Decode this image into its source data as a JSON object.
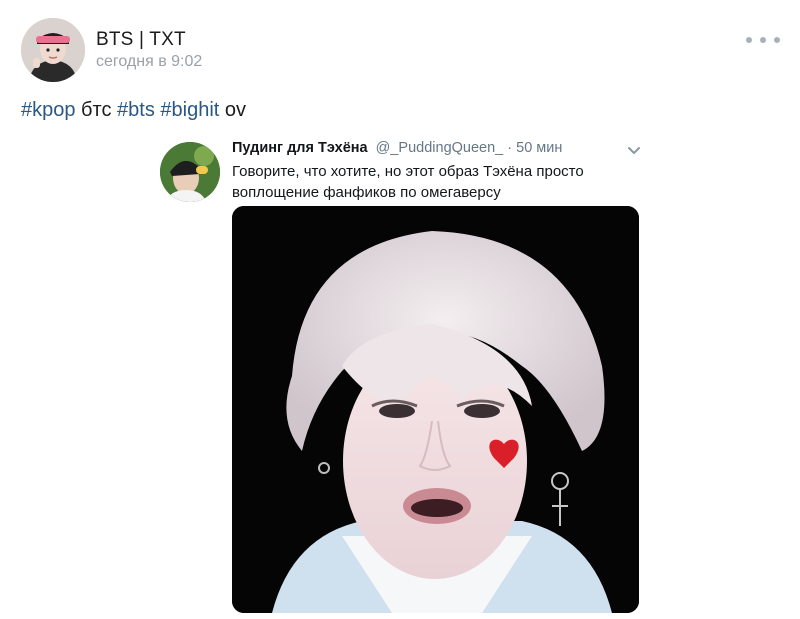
{
  "post": {
    "community_name": "BTS | TXT",
    "time": "сегодня в 9:02",
    "text": {
      "tag1": "#kpop",
      "word1": " бтс ",
      "tag2": "#bts",
      "space": " ",
      "tag3": "#bighit",
      "word2": " ov"
    }
  },
  "tweet": {
    "author": "Пудинг для Тэхёна",
    "handle": "@_PuddingQueen_ · 50 мин",
    "text": "Говорите, что хотите, но этот образ Тэхёна просто воплощение фанфиков по омегаверсу"
  },
  "icons": {
    "more": "more-horizontal-icon",
    "chevron": "chevron-down-icon"
  },
  "colors": {
    "link": "#2a5885",
    "muted": "#9aa0a8",
    "heart": "#d81f2a"
  }
}
